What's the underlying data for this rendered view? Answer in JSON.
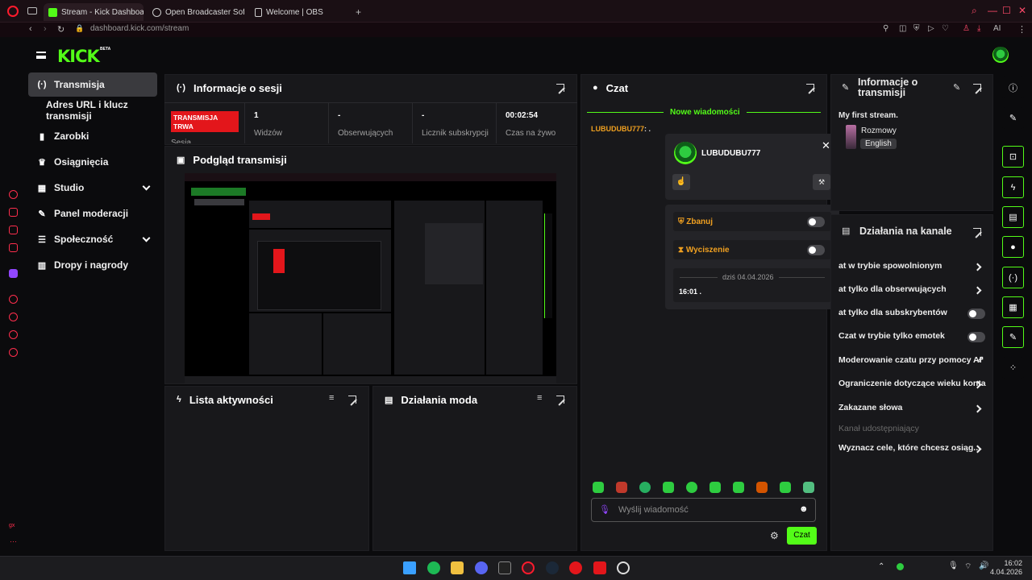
{
  "browser": {
    "tabs": [
      {
        "label": "Stream - Kick Dashboard"
      },
      {
        "label": "Open Broadcaster Softw..."
      },
      {
        "label": "Welcome | OBS"
      }
    ],
    "url": "dashboard.kick.com/stream",
    "ai_label": "AI"
  },
  "brand": {
    "logo": "KICK",
    "beta": "BETA"
  },
  "nav": {
    "items": [
      {
        "label": "Transmisja",
        "icon": "broadcast-icon"
      },
      {
        "label": "Adres URL i klucz transmisji"
      },
      {
        "label": "Zarobki",
        "icon": "chart-icon"
      },
      {
        "label": "Osiągnięcia",
        "icon": "trophy-icon"
      },
      {
        "label": "Studio",
        "icon": "studio-icon"
      },
      {
        "label": "Panel moderacji",
        "icon": "wrench-icon"
      },
      {
        "label": "Społeczność",
        "icon": "community-icon"
      },
      {
        "label": "Dropy i nagrody",
        "icon": "gift-icon"
      }
    ]
  },
  "session": {
    "title": "Informacje o sesji",
    "status_badge": "TRANSMISJA TRWA",
    "status_label": "Sesja",
    "stats": [
      {
        "value": "1",
        "label": "Widzów"
      },
      {
        "value": "-",
        "label": "Obserwujących"
      },
      {
        "value": "-",
        "label": "Licznik subskrypcji"
      },
      {
        "value": "00:02:54",
        "label": "Czas na żywo"
      }
    ]
  },
  "preview": {
    "title": "Podgląd transmisji"
  },
  "activity": {
    "title": "Lista aktywności"
  },
  "modactions": {
    "title": "Działania moda"
  },
  "chat": {
    "title": "Czat",
    "new_messages": "Nowe wiadomości",
    "message_user": "LUBUDUBU777",
    "message_text": ": .",
    "input_placeholder": "Wyślij wiadomość",
    "send_label": "Czat",
    "popup": {
      "username": "LUBUDUBU777",
      "ban_label": "Zbanuj",
      "timeout_label": "Wyciszenie",
      "date": "dziś 04.04.2026",
      "msg_time": "16:01",
      "msg_text": "."
    }
  },
  "stream_info": {
    "title_line1": "Informacje o",
    "title_line2": "transmisji",
    "stream_title": "My first stream.",
    "category": "Rozmowy",
    "language": "English"
  },
  "channel_actions": {
    "title": "Działania na kanale",
    "rows": [
      {
        "label": "at w trybie spowolnionym",
        "control": "chevron"
      },
      {
        "label": "at tylko dla obserwujących",
        "control": "chevron"
      },
      {
        "label": "at tylko dla subskrybentów",
        "control": "toggle"
      },
      {
        "label": "Czat w trybie tylko emotek",
        "control": "toggle"
      },
      {
        "label": "Moderowanie czatu przy pomocy AI",
        "control": "external"
      },
      {
        "label": "Ograniczenie dotyczące wieku konta",
        "control": "chevron"
      },
      {
        "label": "Zakazane słowa",
        "control": "chevron"
      },
      {
        "label": "Kanał udostępniający",
        "control": "none"
      },
      {
        "label": "Wyznacz cele, które chcesz osiąg...",
        "control": "chevron"
      }
    ]
  },
  "taskbar": {
    "time": "16:02",
    "date": "4.04.2026"
  },
  "colors": {
    "accent": "#53fc18",
    "live_red": "#e3161b",
    "panel": "#18181b"
  }
}
